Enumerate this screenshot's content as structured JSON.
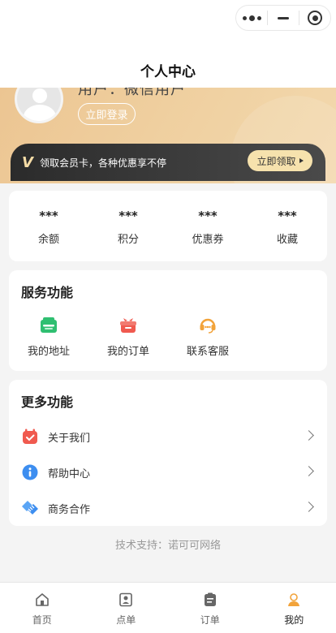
{
  "header": {
    "title": "个人中心"
  },
  "profile": {
    "username": "用户：微信用户",
    "login_label": "立即登录"
  },
  "vip": {
    "badge": "V",
    "text": "领取会员卡，各种优惠享不停",
    "button_label": "立即领取"
  },
  "stats": [
    {
      "value": "***",
      "label": "余额"
    },
    {
      "value": "***",
      "label": "积分"
    },
    {
      "value": "***",
      "label": "优惠券"
    },
    {
      "value": "***",
      "label": "收藏"
    }
  ],
  "service": {
    "title": "服务功能",
    "items": [
      {
        "label": "我的地址",
        "icon": "address-icon",
        "color": "#2fbf71"
      },
      {
        "label": "我的订单",
        "icon": "order-gift-icon",
        "color": "#f05a4f"
      },
      {
        "label": "联系客服",
        "icon": "headset-icon",
        "color": "#f2a33a"
      }
    ]
  },
  "more": {
    "title": "更多功能",
    "items": [
      {
        "label": "关于我们",
        "icon": "calendar-icon",
        "color": "#f05a4f"
      },
      {
        "label": "帮助中心",
        "icon": "info-icon",
        "color": "#3d8ef0"
      },
      {
        "label": "商务合作",
        "icon": "handshake-icon",
        "color": "#3d8ef0"
      }
    ]
  },
  "footer": {
    "support": "技术支持：诺可可网络"
  },
  "tabbar": {
    "items": [
      {
        "label": "首页",
        "icon": "home-icon"
      },
      {
        "label": "点单",
        "icon": "menu-icon"
      },
      {
        "label": "订单",
        "icon": "clipboard-icon"
      },
      {
        "label": "我的",
        "icon": "user-icon",
        "active": true
      }
    ],
    "active_color": "#f2a33a"
  }
}
